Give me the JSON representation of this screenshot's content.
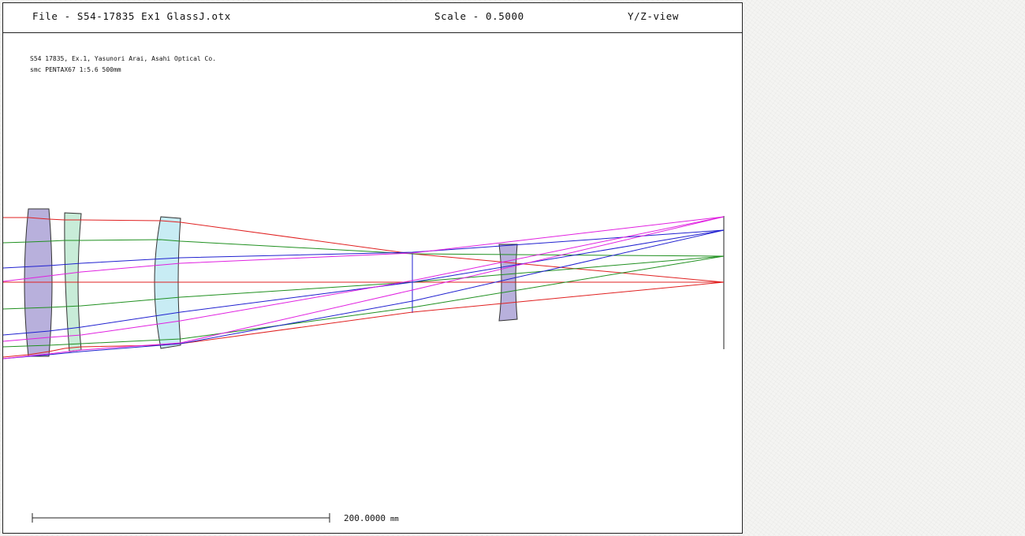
{
  "header": {
    "file_label": "File - S54-17835 Ex1 GlassJ.otx",
    "scale_label": "Scale - 0.5000",
    "view_label": "Y/Z-view"
  },
  "notes": {
    "line1": "S54 17835, Ex.1, Yasunori Arai, Asahi Optical Co.",
    "line2": "smc PENTAX67 1:5.6 500mm"
  },
  "scale_bar": {
    "value": "200.0000",
    "unit": "mm"
  },
  "colors": {
    "ray_red": "#e02020",
    "ray_green": "#209020",
    "ray_blue": "#2020d0",
    "ray_magenta": "#e020e0",
    "lens_purple": "#b8b0dc",
    "lens_green": "#c8ecd8",
    "lens_cyan": "#c8ecf4"
  }
}
